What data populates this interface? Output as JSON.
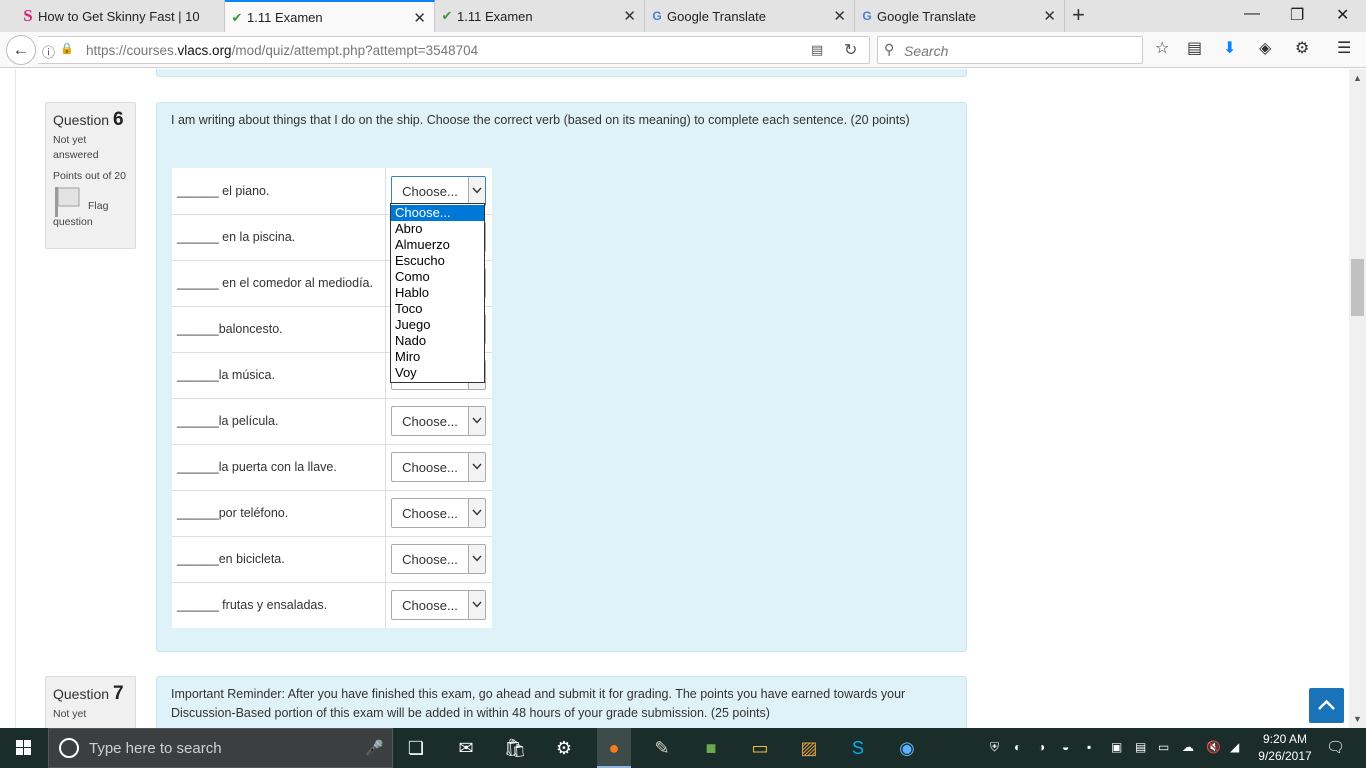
{
  "browser": {
    "tabs": [
      {
        "title": "How to Get Skinny Fast | 10",
        "favicon": "s-logo-icon",
        "active": false
      },
      {
        "title": "1.11 Examen",
        "favicon": "vlacs-check-icon",
        "active": true
      },
      {
        "title": "1.11 Examen",
        "favicon": "vlacs-check-icon",
        "active": false
      },
      {
        "title": "Google Translate",
        "favicon": "google-translate-icon",
        "active": false
      },
      {
        "title": "Google Translate",
        "favicon": "google-translate-icon",
        "active": false
      }
    ],
    "url_prefix": "https://courses.",
    "url_domain": "vlacs.org",
    "url_path": "/mod/quiz/attempt.php?attempt=3548704",
    "search_placeholder": "Search"
  },
  "question6": {
    "label": "Question",
    "number": "6",
    "state_line1": "Not yet",
    "state_line2": "answered",
    "points": "Points out of 20",
    "flag_line1": "Flag",
    "flag_line2": "question",
    "text": "I am writing about things that I do on the ship. Choose the correct verb (based on its meaning) to complete each sentence. (20 points)",
    "rows": [
      {
        "stem": "______ el piano.",
        "selected": "Choose..."
      },
      {
        "stem": "______ en la piscina.",
        "selected": "Choose..."
      },
      {
        "stem": "______ en el comedor al mediodía.",
        "selected": "Choose..."
      },
      {
        "stem": "______baloncesto.",
        "selected": "Choose..."
      },
      {
        "stem": "______la música.",
        "selected": "Choose..."
      },
      {
        "stem": "______la película.",
        "selected": "Choose..."
      },
      {
        "stem": "______la puerta con la llave.",
        "selected": "Choose..."
      },
      {
        "stem": "______por teléfono.",
        "selected": "Choose..."
      },
      {
        "stem": "______en bicicleta.",
        "selected": "Choose..."
      },
      {
        "stem": "______ frutas y ensaladas.",
        "selected": "Choose..."
      }
    ],
    "dropdown_options": [
      "Choose...",
      "Abro",
      "Almuerzo",
      "Escucho",
      "Como",
      "Hablo",
      "Toco",
      "Juego",
      "Nado",
      "Miro",
      "Voy"
    ],
    "highlighted_option": "Choose..."
  },
  "question7": {
    "label": "Question",
    "number": "7",
    "state_line1": "Not yet",
    "text": "Important Reminder: After you have finished this exam, go ahead and submit it for grading. The points you have earned towards your Discussion-Based portion of this exam will be added in within 48 hours of your grade submission. (25 points)"
  },
  "taskbar": {
    "search_placeholder": "Type here to search",
    "time": "9:20 AM",
    "date": "9/26/2017"
  },
  "colors": {
    "question_bg": "#def2f8",
    "info_bg": "#f0f0f0",
    "highlight": "#0078d7",
    "accent_tab": "#0a84ff",
    "backtop": "#1a73b8"
  }
}
